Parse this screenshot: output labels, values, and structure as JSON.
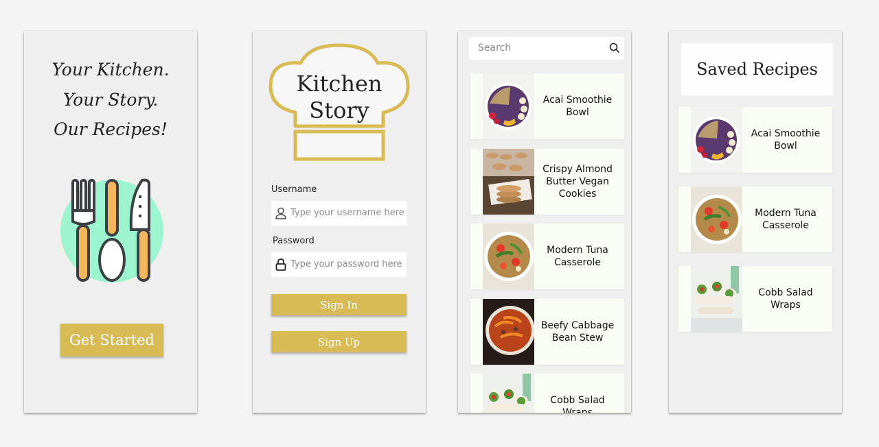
{
  "welcome": {
    "tagline": [
      "Your Kitchen.",
      "Your Story.",
      "Our Recipes!"
    ],
    "cta_label": "Get Started",
    "icons": [
      "fork-icon",
      "spoon-icon",
      "knife-icon"
    ]
  },
  "login": {
    "logo_text": [
      "Kitchen",
      "Story"
    ],
    "username_label": "Username",
    "username_placeholder": "Type your username here",
    "password_label": "Password",
    "password_placeholder": "Type your password here",
    "signin_label": "Sign In",
    "signup_label": "Sign Up"
  },
  "browse": {
    "search_placeholder": "Search",
    "recipes": [
      {
        "name": "Acai Smoothie\nBowl",
        "image": "acai-bowl"
      },
      {
        "name": "Crispy Almond\nButter Vegan\nCookies",
        "image": "cookies"
      },
      {
        "name": "Modern Tuna\nCasserole",
        "image": "pasta-salad"
      },
      {
        "name": "Beefy Cabbage\nBean Stew",
        "image": "stew"
      },
      {
        "name": "Cobb Salad\nWraps",
        "image": "wraps"
      }
    ]
  },
  "saved": {
    "title": "Saved Recipes",
    "recipes": [
      {
        "name": "Acai Smoothie\nBowl",
        "image": "acai-bowl"
      },
      {
        "name": "Modern Tuna\nCasserole",
        "image": "pasta-salad"
      },
      {
        "name": "Cobb Salad\nWraps",
        "image": "wraps"
      }
    ]
  },
  "colors": {
    "accent_gold": "#d9bb55",
    "mint": "#9df5cf",
    "card_bg": "#fafdf5",
    "screen_bg": "#efefef"
  }
}
